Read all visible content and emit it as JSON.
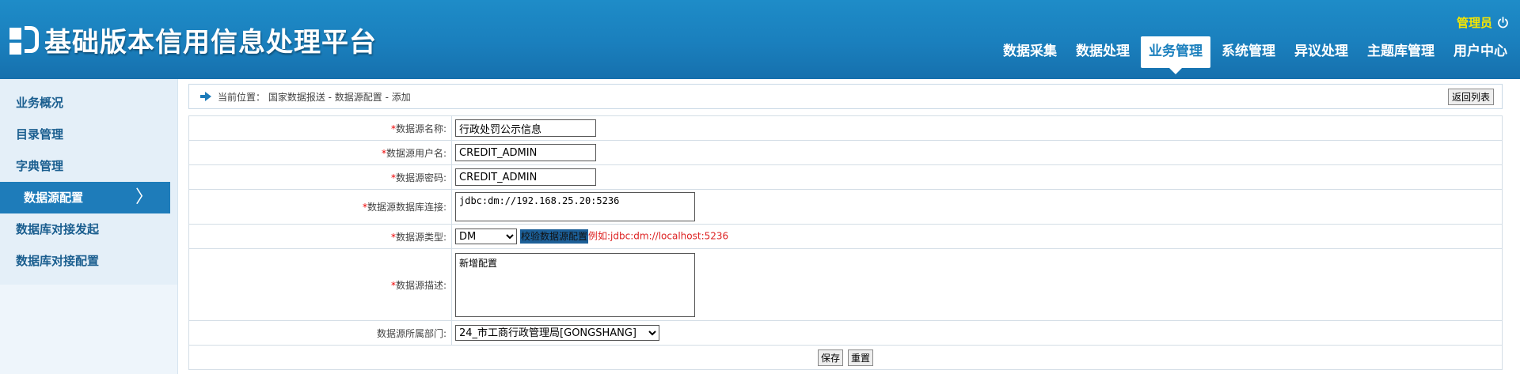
{
  "header": {
    "title": "基础版本信用信息处理平台",
    "user": "管理员",
    "nav": [
      {
        "label": "数据采集"
      },
      {
        "label": "数据处理"
      },
      {
        "label": "业务管理"
      },
      {
        "label": "系统管理"
      },
      {
        "label": "异议处理"
      },
      {
        "label": "主题库管理"
      },
      {
        "label": "用户中心"
      }
    ],
    "active_nav": "业务管理",
    "accent_color": "#1a7fbd",
    "user_color": "#f6e600"
  },
  "sidebar": {
    "items": [
      {
        "label": "业务概况"
      },
      {
        "label": "目录管理"
      },
      {
        "label": "字典管理"
      },
      {
        "label": "数据源配置"
      },
      {
        "label": "数据库对接发起"
      },
      {
        "label": "数据库对接配置"
      }
    ],
    "active": "数据源配置"
  },
  "breadcrumb": {
    "text": "当前位置： 国家数据报送 - 数据源配置 - 添加",
    "back_label": "返回列表"
  },
  "form": {
    "required_mark": "*",
    "name_label": "数据源名称:",
    "name_value": "行政处罚公示信息",
    "user_label": "数据源用户名:",
    "user_value": "CREDIT_ADMIN",
    "password_label": "数据源密码:",
    "password_value": "CREDIT_ADMIN",
    "conn_label": "数据源数据库连接:",
    "conn_value": "jdbc:dm://192.168.25.20:5236",
    "type_label": "数据源类型:",
    "type_value": "DM",
    "verify_label": "校验数据源配置",
    "type_hint": "例如:jdbc:dm://localhost:5236",
    "desc_label": "数据源描述:",
    "desc_value": "新增配置",
    "dept_label": "数据源所属部门:",
    "dept_value": "24_市工商行政管理局[GONGSHANG]"
  },
  "actions": {
    "save_label": "保存",
    "reset_label": "重置"
  }
}
